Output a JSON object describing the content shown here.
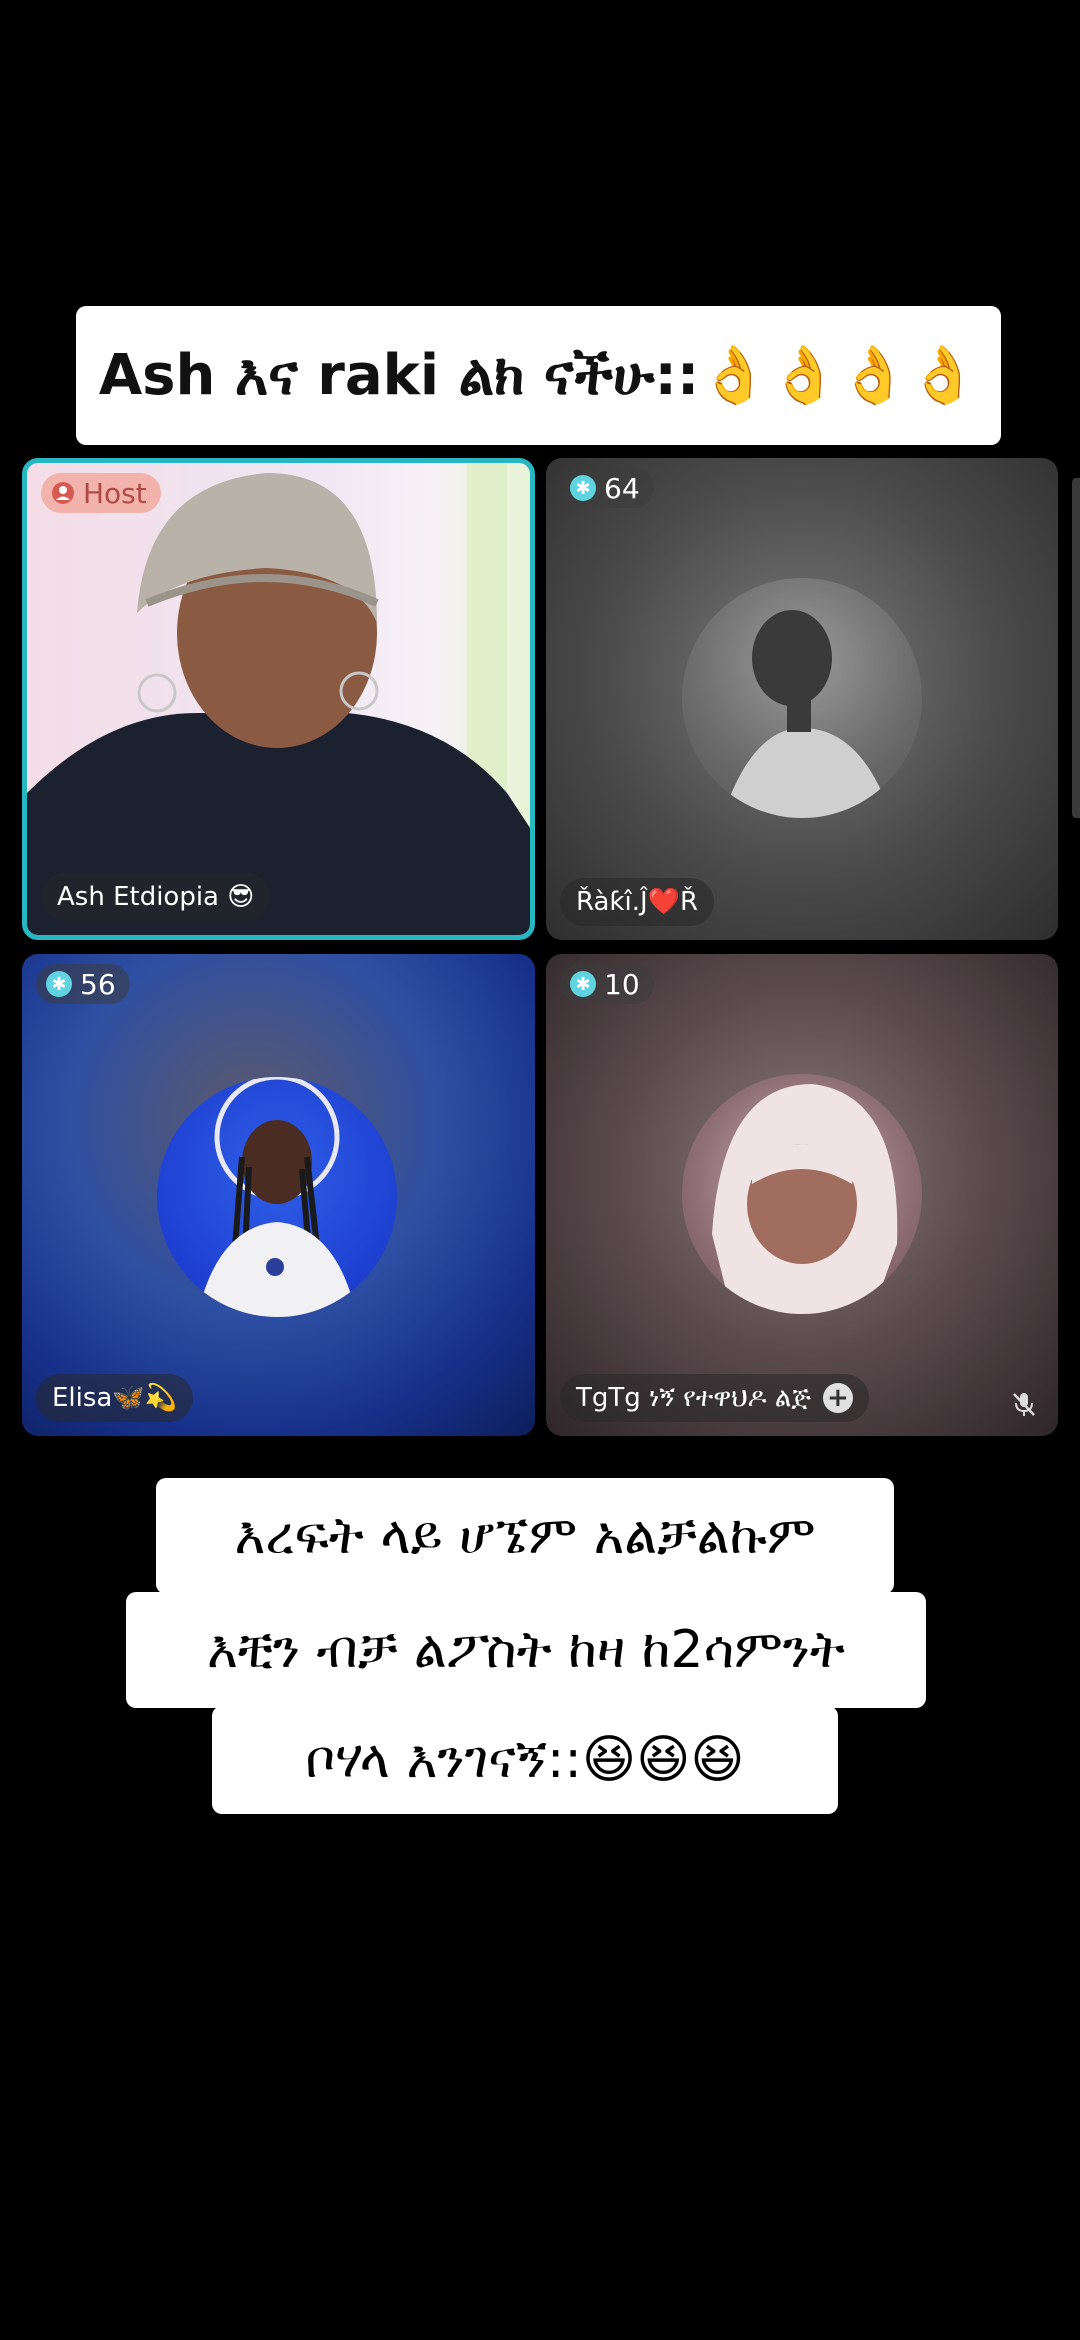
{
  "top_caption": "Ash እና raki ልክ ናችሁ::👌👌👌👌",
  "tiles": [
    {
      "badge": "Host",
      "name": "Ash Etdiopia 😎",
      "muted": false
    },
    {
      "badge": "64",
      "name": "Řàƙî.Ĵ❤️Ř",
      "muted": false
    },
    {
      "badge": "56",
      "name": "Elisa🦋💫",
      "muted": false
    },
    {
      "badge": "10",
      "name": "TgTg ነኝ የተዋህዶ ልጅ",
      "muted": true
    }
  ],
  "bottom_caption": {
    "line1": "እረፍት ላይ ሆኜም አልቻልኩም",
    "line2": "እቺን ብቻ ልፖስት ከዛ ከ2ሳምንት",
    "line3": "ቦሃላ እንገናኝ::😆😆😆"
  },
  "colors": {
    "host_border": "#27b7c2",
    "host_badge": "#f3b3ad",
    "count_icon": "#5fd3df"
  },
  "icons": {
    "host": "host-person-icon",
    "count": "star-count-icon",
    "add": "plus-icon",
    "mute": "mic-off-icon"
  }
}
